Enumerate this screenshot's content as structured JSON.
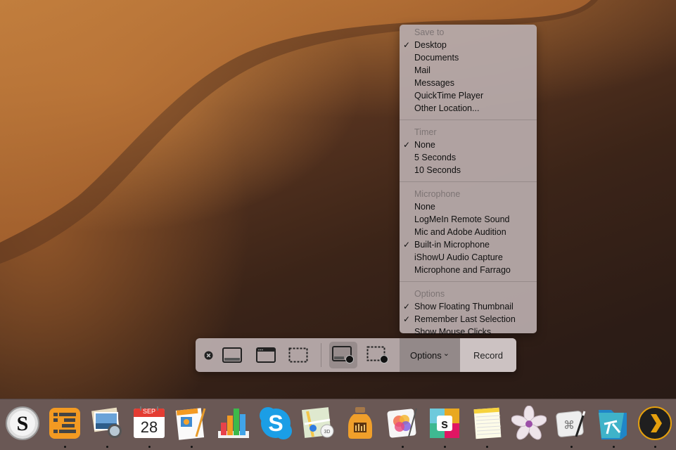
{
  "menu": {
    "sections": [
      {
        "header": "Save to",
        "items": [
          {
            "label": "Desktop",
            "checked": true
          },
          {
            "label": "Documents",
            "checked": false
          },
          {
            "label": "Mail",
            "checked": false
          },
          {
            "label": "Messages",
            "checked": false
          },
          {
            "label": "QuickTime Player",
            "checked": false
          },
          {
            "label": "Other Location...",
            "checked": false
          }
        ]
      },
      {
        "header": "Timer",
        "items": [
          {
            "label": "None",
            "checked": true
          },
          {
            "label": "5 Seconds",
            "checked": false
          },
          {
            "label": "10 Seconds",
            "checked": false
          }
        ]
      },
      {
        "header": "Microphone",
        "items": [
          {
            "label": "None",
            "checked": false
          },
          {
            "label": "LogMeIn Remote Sound",
            "checked": false
          },
          {
            "label": "Mic and Adobe Audition",
            "checked": false
          },
          {
            "label": "Built-in Microphone",
            "checked": true
          },
          {
            "label": "iShowU Audio Capture",
            "checked": false
          },
          {
            "label": "Microphone and Farrago",
            "checked": false
          }
        ]
      },
      {
        "header": "Options",
        "items": [
          {
            "label": "Show Floating Thumbnail",
            "checked": true
          },
          {
            "label": "Remember Last Selection",
            "checked": true
          },
          {
            "label": "Show Mouse Clicks",
            "checked": false
          }
        ]
      }
    ],
    "check_glyph": "✓"
  },
  "toolbar": {
    "close_icon": "close-icon",
    "capture_entire_screen": "capture-entire-screen-icon",
    "capture_window": "capture-window-icon",
    "capture_selection": "capture-selection-icon",
    "record_entire_screen": "record-entire-screen-icon",
    "record_selection": "record-selection-icon",
    "options_label": "Options",
    "options_chevron": "⌄",
    "record_label": "Record",
    "selected_mode": "record-entire-screen"
  },
  "dock": {
    "apps": [
      {
        "name": "Scrivener",
        "running": false
      },
      {
        "name": "OmniOutliner",
        "running": true
      },
      {
        "name": "Preview",
        "running": true
      },
      {
        "name": "Calendar",
        "running": true,
        "month": "SEP",
        "day": "28"
      },
      {
        "name": "Pages",
        "running": true
      },
      {
        "name": "Numbers",
        "running": false
      },
      {
        "name": "Skype",
        "running": false
      },
      {
        "name": "Maps",
        "running": false
      },
      {
        "name": "Farrago",
        "running": false
      },
      {
        "name": "Pixelmator Pro",
        "running": true
      },
      {
        "name": "Slack",
        "running": true
      },
      {
        "name": "Notes",
        "running": true
      },
      {
        "name": "Flower App",
        "running": false
      },
      {
        "name": "Keyboard Maestro",
        "running": true
      },
      {
        "name": "FileMaker",
        "running": true
      },
      {
        "name": "Plex",
        "running": true
      }
    ]
  }
}
